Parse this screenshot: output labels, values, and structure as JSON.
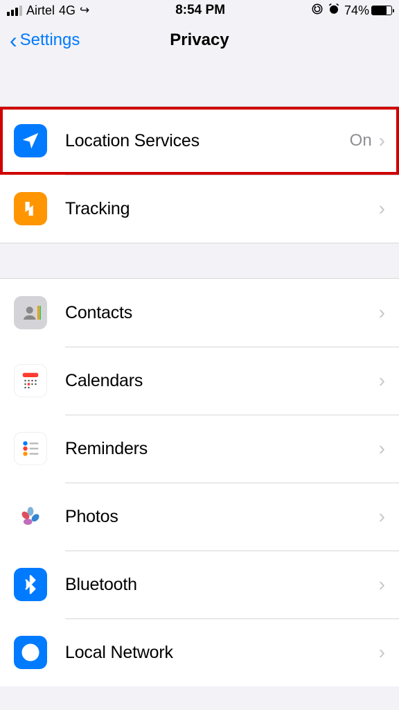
{
  "status": {
    "carrier": "Airtel",
    "network": "4G",
    "call_icon": "↪",
    "time": "8:54 PM",
    "rotation_lock": "⊕",
    "alarm": "⏰",
    "battery_pct": "74%"
  },
  "nav": {
    "back_label": "Settings",
    "title": "Privacy"
  },
  "section1": [
    {
      "label": "Location Services",
      "value": "On",
      "highlight": true,
      "icon": "location"
    },
    {
      "label": "Tracking",
      "value": "",
      "highlight": false,
      "icon": "tracking"
    }
  ],
  "section2": [
    {
      "label": "Contacts",
      "icon": "contacts"
    },
    {
      "label": "Calendars",
      "icon": "calendar"
    },
    {
      "label": "Reminders",
      "icon": "reminders"
    },
    {
      "label": "Photos",
      "icon": "photos"
    },
    {
      "label": "Bluetooth",
      "icon": "bluetooth"
    },
    {
      "label": "Local Network",
      "icon": "network"
    }
  ]
}
